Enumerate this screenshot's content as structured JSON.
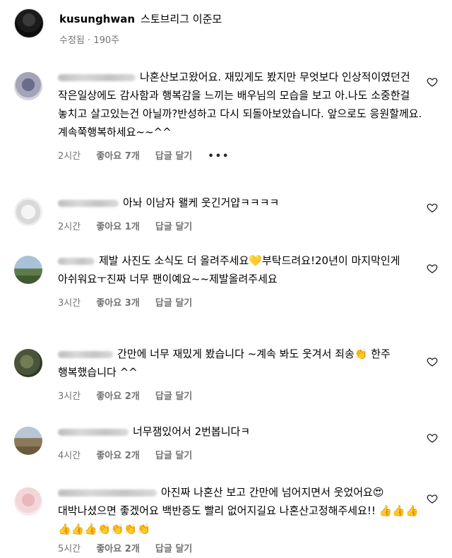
{
  "post": {
    "username": "kusunghwan",
    "caption": "스토브리그 이준모",
    "edited": "수정됨",
    "separator": "·",
    "age": "190주"
  },
  "comments": [
    {
      "text": "나혼산보고왔어요. 재밌게도 봤지만 무엇보다 인상적이였던건 작은일상에도 감사함과 행복감을 느끼는 배우님의 모습을 보고 아.나도 소중한걸 놓치고 살고있는건 아닐까?반성하고 다시 되돌아보았습니다. 앞으로도 응원할께요.계속쭉행복하세요~~^^",
      "time": "2시간",
      "likes": "좋아요 7개",
      "reply": "답글 달기",
      "more": "•••"
    },
    {
      "text": "아놔 이남자 왤케 웃긴거얍ㅋㅋㅋㅋ",
      "time": "2시간",
      "likes": "좋아요 1개",
      "reply": "답글 달기"
    },
    {
      "text_a": "제발 사진도 소식도 더 올려주세요",
      "emoji_a": "💛",
      "text_b": "부탁드려요!20년이 마지막인게 아쉬워요ㅜ진짜 너무 팬이예요~~제발올려주세요",
      "time": "3시간",
      "likes": "좋아요 3개",
      "reply": "답글 달기"
    },
    {
      "text_a": "간만에 너무 재밌게 봤습니다 ~계속 봐도 웃겨서 죄송",
      "emoji_a": "👏",
      "text_b": " 한주 행복했습니다 ^^",
      "time": "3시간",
      "likes": "좋아요 2개",
      "reply": "답글 달기"
    },
    {
      "text": "너무잼있어서 2번봅니다ㅋ",
      "time": "4시간",
      "likes": "좋아요 2개",
      "reply": "답글 달기"
    },
    {
      "text_a": "아진짜 나혼산 보고 간만에 넘어지면서 웃었어요",
      "emoji_a": "😍",
      "text_b": " 대박나셨으면 좋겠어요 백반증도 빨리 없어지길요 나혼산고정해주세요!! ",
      "emoji_b": "👍👍👍👍👍👍👏👏👏👏",
      "time": "5시간",
      "likes": "좋아요 2개",
      "reply": "답글 달기"
    }
  ],
  "icons": {
    "like": "heart-outline-icon"
  },
  "colors": {
    "meta": "#737373",
    "text": "#000000"
  }
}
